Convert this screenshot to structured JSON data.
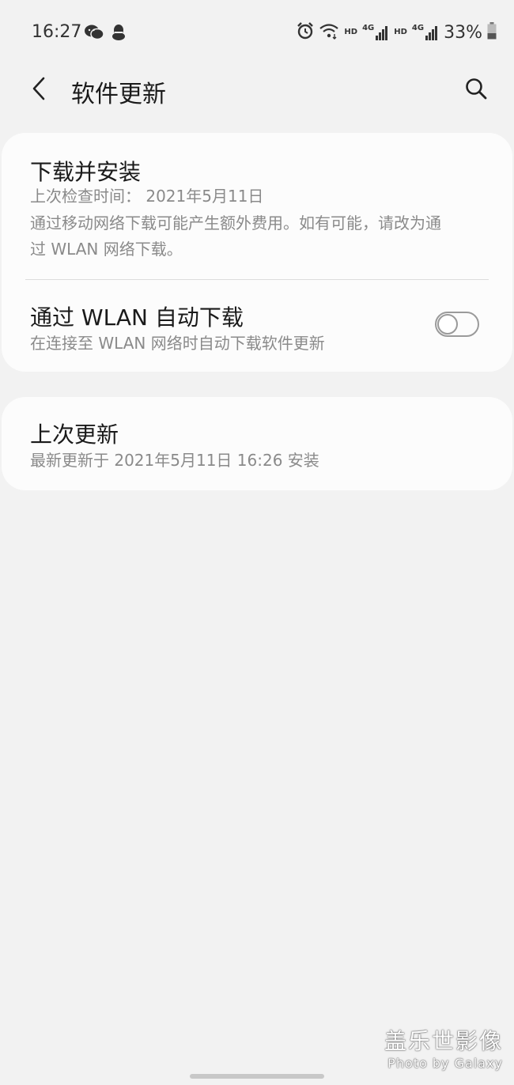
{
  "status_bar": {
    "time": "16:27",
    "left_icons": [
      "wechat-icon",
      "qq-icon"
    ],
    "right_icons": [
      "alarm-icon",
      "wifi-icon",
      "hd-icon",
      "4g-signal-icon",
      "hd-icon",
      "4g-signal-icon",
      "battery-icon"
    ],
    "hd_label": "HD",
    "net_label": "4G",
    "battery": "33%"
  },
  "app_bar": {
    "title": "软件更新",
    "back_icon": "back-arrow-icon",
    "search_icon": "search-icon"
  },
  "card1": {
    "download_install": {
      "title": "下载并安装",
      "last_check": "上次检查时间： 2021年5月11日",
      "note_line1": "通过移动网络下载可能产生额外费用。如有可能，请改为通",
      "note_line2": "过 WLAN 网络下载。"
    },
    "auto_download": {
      "title": "通过 WLAN 自动下载",
      "subtitle": "在连接至 WLAN 网络时自动下载软件更新",
      "enabled": false
    }
  },
  "card2": {
    "last_update": {
      "title": "上次更新",
      "subtitle": "最新更新于 2021年5月11日 16:26 安装"
    }
  },
  "watermark": {
    "main": "盖乐世影像",
    "sub": "Photo by Galaxy"
  },
  "colors": {
    "background": "#f2f2f2",
    "card": "#fcfcfc",
    "subtext": "#8a8a8a",
    "toggle_off": "#9a9a9a"
  }
}
